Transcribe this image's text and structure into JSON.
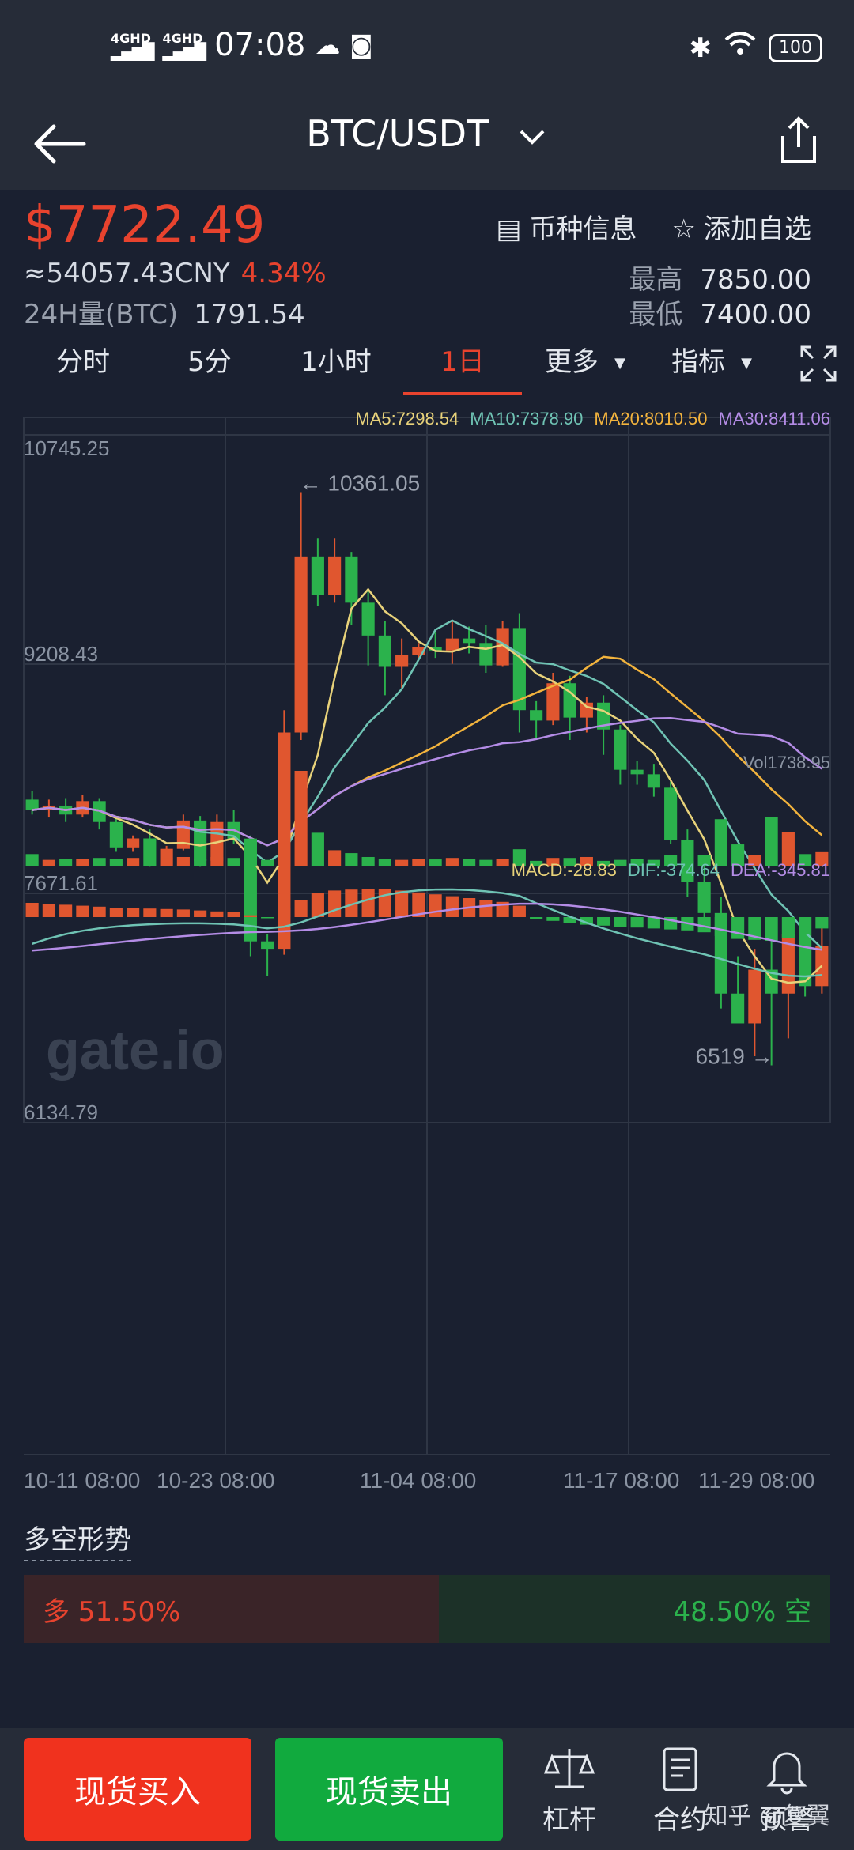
{
  "status_bar": {
    "network_1": "4GHD",
    "network_2": "4GHD",
    "time": "07:08",
    "battery": "100"
  },
  "header": {
    "pair": "BTC/USDT"
  },
  "ticker": {
    "price": "$7722.49",
    "cny": "≈54057.43CNY",
    "change": "4.34%",
    "vol_label": "24H量(BTC)",
    "vol_value": "1791.54",
    "coin_info": "币种信息",
    "add_favorite": "添加自选",
    "high_label": "最高",
    "high_value": "7850.00",
    "low_label": "最低",
    "low_value": "7400.00"
  },
  "tabs": [
    "分时",
    "5分",
    "1小时",
    "1日",
    "更多",
    "指标"
  ],
  "active_tab": "1日",
  "chart": {
    "ma_legend": [
      {
        "text": "MA5:7298.54",
        "color": "#e8d27a"
      },
      {
        "text": "MA10:7378.90",
        "color": "#6fc3b4"
      },
      {
        "text": "MA20:8010.50",
        "color": "#f2b33d"
      },
      {
        "text": "MA30:8411.06",
        "color": "#b48ce6"
      }
    ],
    "y_labels": [
      "10745.25",
      "9208.43",
      "7671.61",
      "6134.79"
    ],
    "max_label": "← 10361.05",
    "min_label": "6519 →",
    "watermark": "gate.io",
    "vol_label": "Vol1738.95",
    "macd_legend": [
      {
        "text": "MACD:-28.83",
        "color": "#e8d27a"
      },
      {
        "text": "DIF:-374.64",
        "color": "#6fc3b4"
      },
      {
        "text": "DEA:-345.81",
        "color": "#b48ce6"
      }
    ],
    "x_labels": [
      "10-11 08:00",
      "10-23 08:00",
      "11-04 08:00",
      "11-17 08:00",
      "11-29 08:00"
    ]
  },
  "chart_data": {
    "type": "candlestick",
    "ylim": [
      6134.79,
      10745.25
    ],
    "max": 10361.05,
    "min": 6519,
    "candles": [
      [
        8300,
        8230,
        8360,
        8200
      ],
      [
        8230,
        8260,
        8300,
        8180
      ],
      [
        8260,
        8200,
        8310,
        8150
      ],
      [
        8200,
        8290,
        8330,
        8180
      ],
      [
        8290,
        8150,
        8310,
        8100
      ],
      [
        8150,
        7980,
        8180,
        7950
      ],
      [
        7980,
        8040,
        8060,
        7950
      ],
      [
        8040,
        7900,
        8100,
        7850
      ],
      [
        7900,
        7970,
        7990,
        7880
      ],
      [
        7970,
        8160,
        8200,
        7960
      ],
      [
        8160,
        7890,
        8190,
        7850
      ],
      [
        7890,
        8150,
        8200,
        7870
      ],
      [
        8150,
        8030,
        8230,
        8000
      ],
      [
        8030,
        7350,
        8060,
        7250
      ],
      [
        7350,
        7300,
        7400,
        7120
      ],
      [
        7300,
        8750,
        8900,
        7260
      ],
      [
        8750,
        9930,
        10361.05,
        8700
      ],
      [
        9930,
        9670,
        10050,
        9600
      ],
      [
        9670,
        9930,
        10050,
        9620
      ],
      [
        9930,
        9620,
        9960,
        9470
      ],
      [
        9620,
        9400,
        9700,
        9200
      ],
      [
        9400,
        9190,
        9500,
        9000
      ],
      [
        9190,
        9270,
        9380,
        9050
      ],
      [
        9270,
        9320,
        9350,
        9250
      ],
      [
        9320,
        9300,
        9420,
        9250
      ],
      [
        9300,
        9380,
        9500,
        9210
      ],
      [
        9380,
        9350,
        9460,
        9280
      ],
      [
        9350,
        9200,
        9470,
        9150
      ],
      [
        9200,
        9450,
        9500,
        9190
      ],
      [
        9450,
        8900,
        9550,
        8750
      ],
      [
        8900,
        8830,
        8960,
        8700
      ],
      [
        8830,
        9080,
        9150,
        8800
      ],
      [
        9080,
        8850,
        9130,
        8700
      ],
      [
        8850,
        8950,
        8990,
        8750
      ],
      [
        8950,
        8770,
        9000,
        8600
      ],
      [
        8770,
        8500,
        8800,
        8400
      ],
      [
        8500,
        8470,
        8560,
        8400
      ],
      [
        8470,
        8380,
        8540,
        8320
      ],
      [
        8380,
        8030,
        8420,
        8000
      ],
      [
        8030,
        7750,
        8100,
        7650
      ],
      [
        7750,
        7540,
        7860,
        7500
      ],
      [
        7540,
        7000,
        7650,
        6900
      ],
      [
        7000,
        6800,
        7250,
        6850
      ],
      [
        6800,
        7160,
        7300,
        6580
      ],
      [
        7160,
        7000,
        7390,
        6519
      ],
      [
        7000,
        7400,
        7450,
        6700
      ],
      [
        7400,
        7050,
        7450,
        6980
      ],
      [
        7050,
        7320,
        7500,
        7000
      ]
    ],
    "volumes": [
      120,
      60,
      70,
      70,
      80,
      70,
      80,
      70,
      75,
      90,
      70,
      90,
      80,
      280,
      60,
      380,
      980,
      340,
      160,
      130,
      90,
      70,
      60,
      70,
      65,
      80,
      70,
      60,
      70,
      170,
      50,
      80,
      80,
      90,
      50,
      60,
      70,
      60,
      110,
      50,
      110,
      480,
      220,
      110,
      500,
      350,
      120,
      140
    ],
    "macd": [
      150,
      140,
      130,
      120,
      110,
      100,
      95,
      90,
      85,
      80,
      70,
      60,
      50,
      20,
      -10,
      100,
      180,
      250,
      280,
      290,
      300,
      300,
      280,
      260,
      240,
      220,
      200,
      180,
      160,
      120,
      -20,
      -40,
      -60,
      -80,
      -90,
      -100,
      -110,
      -120,
      -130,
      -140,
      -160,
      -200,
      -230,
      -240,
      -250,
      -220,
      -180,
      -120
    ]
  },
  "sentiment": {
    "title": "多空形势",
    "long_text": "多 51.50%",
    "short_text": "48.50% 空",
    "long_pct": 51.5
  },
  "bottom": {
    "buy": "现货买入",
    "sell": "现货卖出",
    "leverage": "杠杆",
    "contract": "合约",
    "alert": "预警",
    "watermark": "知乎 @复翼"
  }
}
